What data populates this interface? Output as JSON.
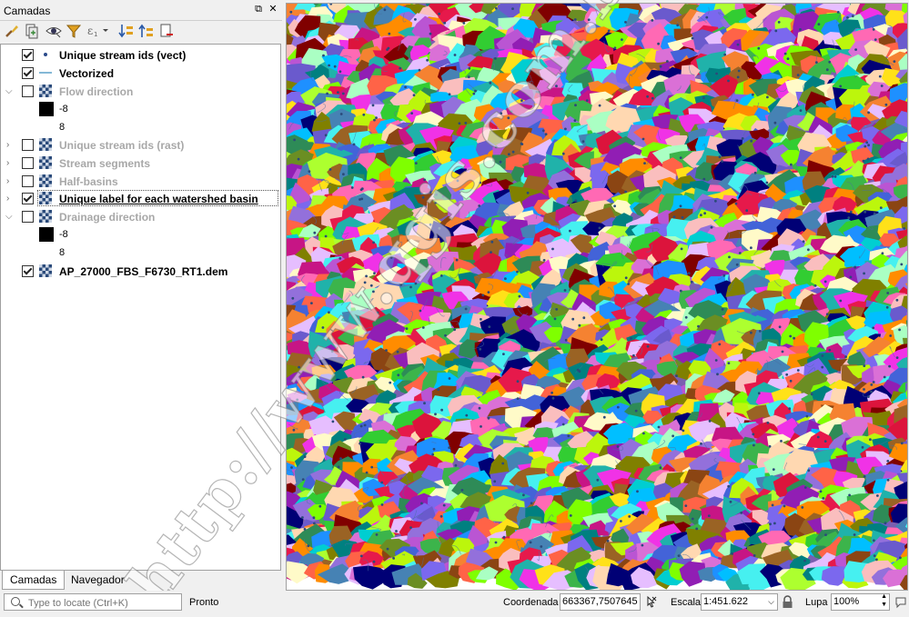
{
  "panel": {
    "title": "Camadas",
    "float_label": "⧉",
    "close_label": "✕"
  },
  "layers": [
    {
      "name": "Unique stream ids (vect)",
      "checked": true,
      "visible_style": "on",
      "icon": "point-layer-icon"
    },
    {
      "name": "Vectorized",
      "checked": true,
      "visible_style": "on",
      "icon": "line-layer-icon"
    },
    {
      "name": "Flow direction",
      "checked": false,
      "visible_style": "off",
      "icon": "raster-layer-icon",
      "expanded": true,
      "legend": [
        "-8",
        "8"
      ]
    },
    {
      "name": "Unique stream ids (rast)",
      "checked": false,
      "visible_style": "off",
      "icon": "raster-layer-icon"
    },
    {
      "name": "Stream segments",
      "checked": false,
      "visible_style": "off",
      "icon": "raster-layer-icon"
    },
    {
      "name": "Half-basins",
      "checked": false,
      "visible_style": "off",
      "icon": "raster-layer-icon"
    },
    {
      "name": "Unique label for each watershed basin",
      "checked": true,
      "visible_style": "selected",
      "icon": "raster-layer-icon"
    },
    {
      "name": "Drainage direction",
      "checked": false,
      "visible_style": "off",
      "icon": "raster-layer-icon",
      "expanded": true,
      "legend": [
        "-8",
        "8"
      ]
    },
    {
      "name": "AP_27000_FBS_F6730_RT1.dem",
      "checked": true,
      "visible_style": "on",
      "icon": "raster-layer-icon"
    }
  ],
  "tabs": [
    "Camadas",
    "Navegador"
  ],
  "status": {
    "locate_placeholder": "Type to locate (Ctrl+K)",
    "message": "Pronto",
    "coord_label": "Coordenada",
    "coord_value": "663367,7507645",
    "scale_label": "Escala",
    "scale_value": "1:451.622",
    "magnifier_label": "Lupa",
    "magnifier_value": "100%"
  },
  "watermark": "http://www.qgis.com.br",
  "colors": {
    "selection_border": "#555555",
    "disabled_text": "#a8a8a8"
  }
}
